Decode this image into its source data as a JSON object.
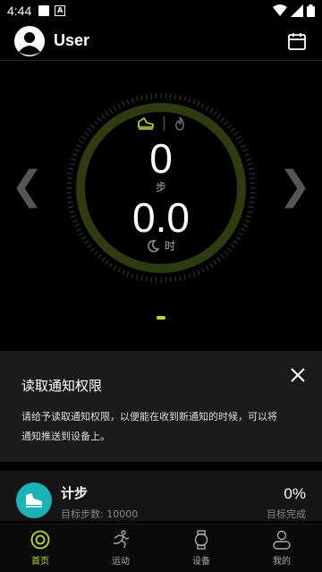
{
  "status_bar": {
    "time": "4:44",
    "icons": [
      "notification-square-icon",
      "a-box-icon",
      "wifi-icon",
      "signal-icon",
      "battery-icon"
    ]
  },
  "header": {
    "title": "User",
    "icons": [
      "avatar-icon",
      "calendar-icon"
    ]
  },
  "dial": {
    "steps_value": "0",
    "steps_unit": "步",
    "hours_value": "0.0",
    "hours_unit": "时",
    "ring_color": "#2e3a10",
    "accent": "#b5e02a",
    "active_mode": "walking"
  },
  "notice": {
    "title": "读取通知权限",
    "body": "请给予读取通知权限，以便能在收到新通知的时候，可以将通知推送到设备上。"
  },
  "step_card": {
    "title": "计步",
    "goal_label": "目标步数:",
    "goal_value": "10000",
    "percent": "0%",
    "done_label": "目标完成"
  },
  "tabs": [
    {
      "label": "首页",
      "icon": "home-target-icon",
      "active": true
    },
    {
      "label": "运动",
      "icon": "running-icon",
      "active": false
    },
    {
      "label": "设备",
      "icon": "watch-icon",
      "active": false
    },
    {
      "label": "我的",
      "icon": "profile-icon",
      "active": false
    }
  ]
}
